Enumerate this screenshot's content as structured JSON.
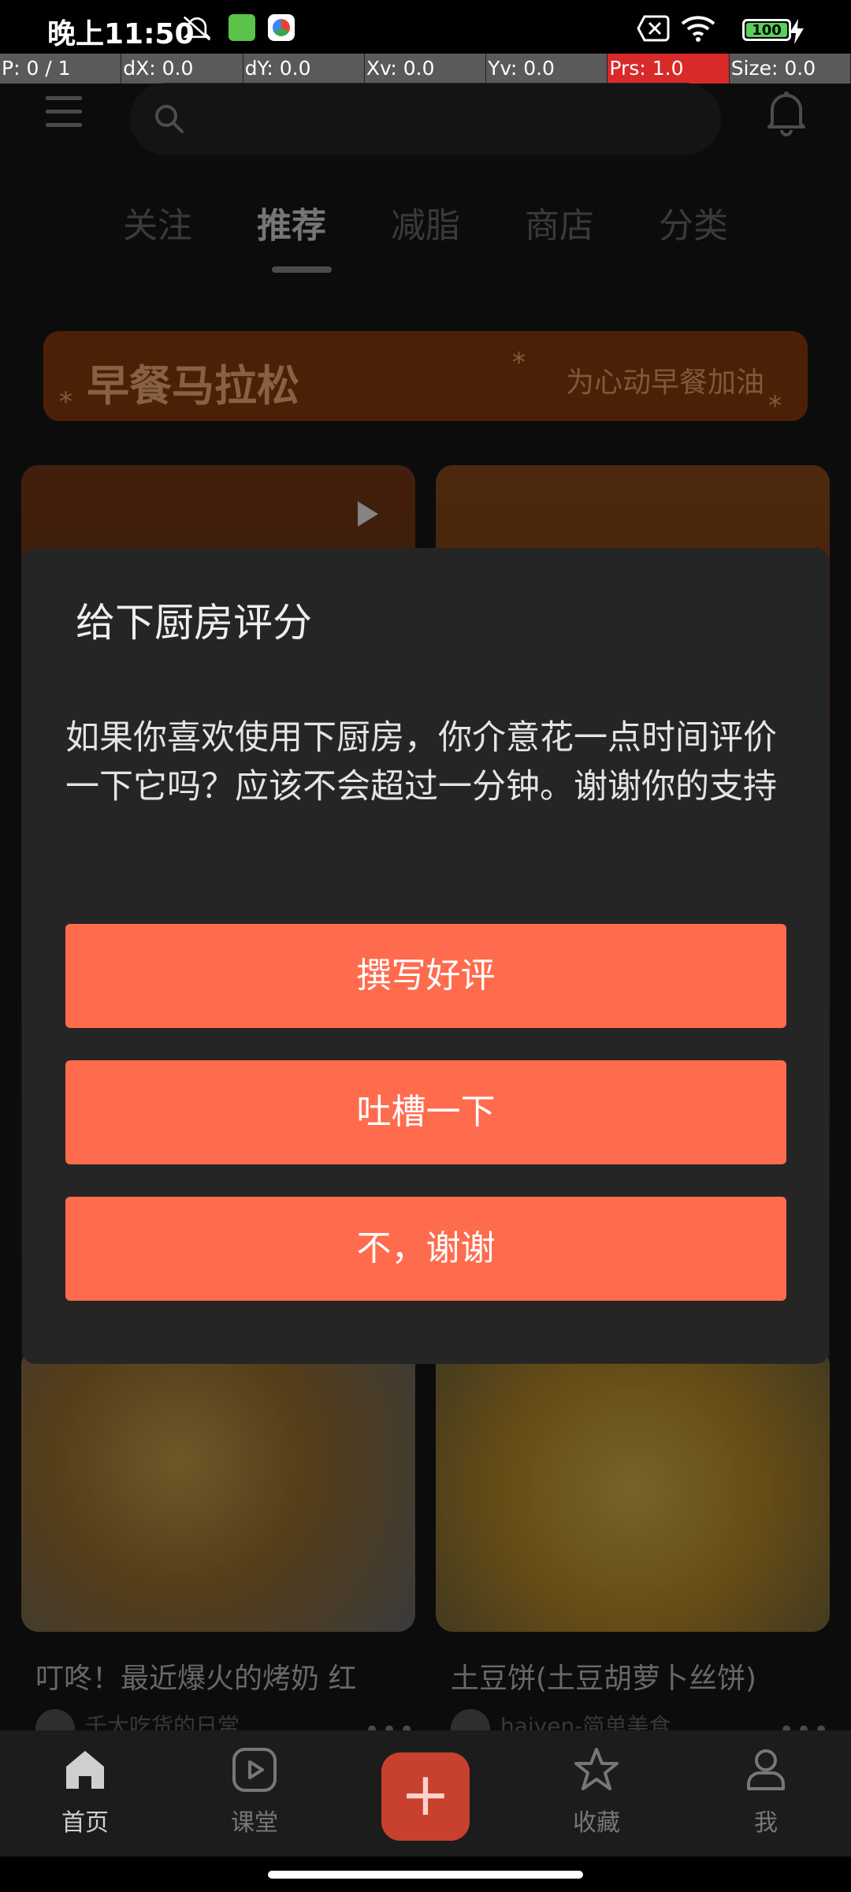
{
  "status_bar": {
    "time": "晚上11:50",
    "battery": "100"
  },
  "debug_bar": {
    "p": "P: 0 / 1",
    "dx": "dX: 0.0",
    "dy": "dY: 0.0",
    "xv": "Xv: 0.0",
    "yv": "Yv: 0.0",
    "prs": "Prs: 1.0",
    "size": "Size: 0.0"
  },
  "header": {
    "search_placeholder": ""
  },
  "tabs": [
    {
      "label": "关注"
    },
    {
      "label": "推荐"
    },
    {
      "label": "减脂"
    },
    {
      "label": "商店"
    },
    {
      "label": "分类"
    }
  ],
  "banner": {
    "title": "早餐马拉松",
    "subtitle": "为心动早餐加油"
  },
  "feed": [
    {
      "title": "叮咚！最近爆火的烤奶 红",
      "author": "千大吃货的日常"
    },
    {
      "title": "土豆饼(土豆胡萝卜丝饼)",
      "author": "haiyen-简单美食"
    }
  ],
  "dialog": {
    "title": "给下厨房评分",
    "message": "如果你喜欢使用下厨房，你介意花一点时间评价一下它吗？应该不会超过一分钟。谢谢你的支持",
    "buttons": [
      "撰写好评",
      "吐槽一下",
      "不，谢谢"
    ]
  },
  "bottom_nav": [
    {
      "label": "首页",
      "icon": "home-icon"
    },
    {
      "label": "课堂",
      "icon": "play-square-icon"
    },
    {
      "label": "",
      "icon": "plus-icon"
    },
    {
      "label": "收藏",
      "icon": "star-icon"
    },
    {
      "label": "我",
      "icon": "person-icon"
    }
  ],
  "colors": {
    "accent": "#FF6B4D",
    "dialog_bg": "#252525",
    "page_bg": "#171717"
  }
}
